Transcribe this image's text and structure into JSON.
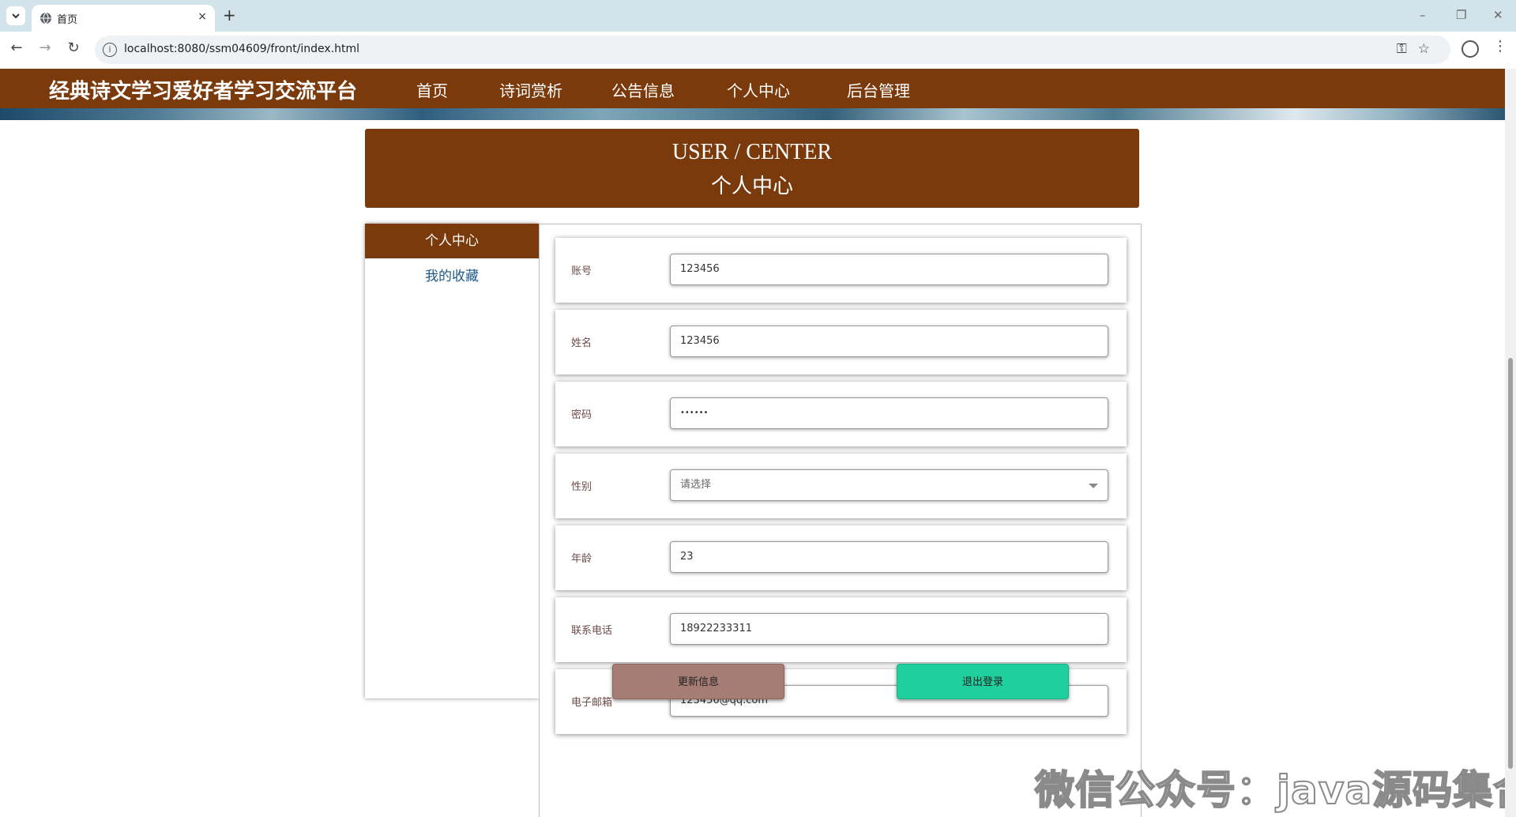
{
  "browser": {
    "tab_title": "首页",
    "tab_close": "×",
    "new_tab": "+",
    "url": "localhost:8080/ssm04609/front/index.html",
    "win_minimize": "–",
    "win_restore": "❐",
    "win_close": "✕"
  },
  "header": {
    "site_title": "经典诗文学习爱好者学习交流平台",
    "nav": [
      "首页",
      "诗词赏析",
      "公告信息",
      "个人中心",
      "后台管理"
    ]
  },
  "banner": {
    "title_en": "USER / CENTER",
    "title_cn": "个人中心"
  },
  "sidebar": {
    "heading": "个人中心",
    "items": [
      "我的收藏"
    ]
  },
  "form": {
    "fields": [
      {
        "label": "账号",
        "value": "123456"
      },
      {
        "label": "姓名",
        "value": "123456"
      },
      {
        "label": "密码",
        "value": "••••••"
      },
      {
        "label": "性别",
        "value": "请选择"
      },
      {
        "label": "年龄",
        "value": "23"
      },
      {
        "label": "联系电话",
        "value": "18922233311"
      },
      {
        "label": "电子邮箱",
        "value": "123456@qq.com"
      }
    ],
    "update_button": "更新信息",
    "logout_button": "退出登录"
  },
  "watermark": "微信公众号：java源码集合",
  "colors": {
    "brand": "#7b3a0b",
    "update_button": "#a67d73",
    "logout_button": "#1fcf9e",
    "link": "#1d5a8a"
  },
  "icons": [
    "tab-list-icon",
    "globe-icon",
    "back-icon",
    "forward-icon",
    "reload-icon",
    "info-icon",
    "key-icon",
    "star-icon",
    "profile-icon",
    "menu-icon"
  ]
}
